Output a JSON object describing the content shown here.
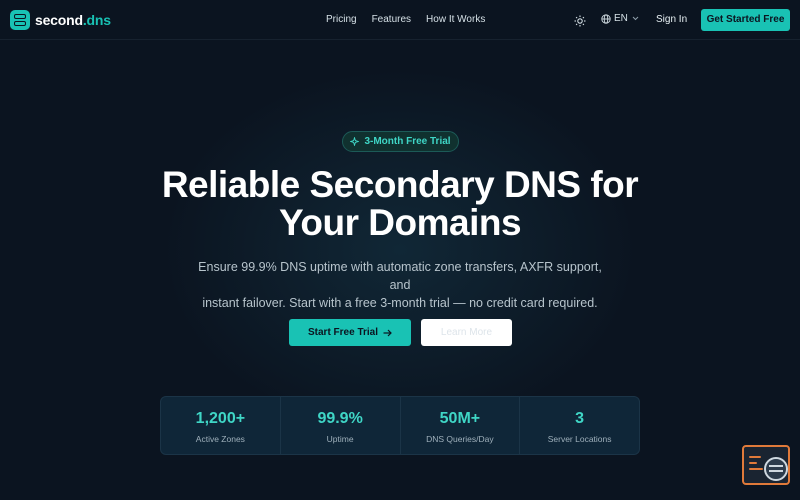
{
  "brand": {
    "name_part1": "second",
    "name_part2": ".dns",
    "accent_color": "#19c2b4"
  },
  "nav": {
    "links": [
      "Pricing",
      "Features",
      "How It Works"
    ],
    "language": "EN",
    "sign_in": "Sign In",
    "cta": "Get Started Free",
    "icons": [
      "sun-icon",
      "globe-icon",
      "chevron-down-icon"
    ]
  },
  "hero": {
    "badge": "3-Month Free Trial",
    "title_line1": "Reliable Secondary DNS for",
    "title_line2": "Your Domains",
    "subtitle_line1": "Ensure 99.9% DNS uptime with automatic zone transfers, AXFR support, and",
    "subtitle_line2": "instant failover. Start with a free 3-month trial — no credit card required.",
    "primary_button": "Start Free Trial",
    "secondary_button": "Learn More"
  },
  "stats": [
    {
      "value": "1,200+",
      "label": "Active Zones"
    },
    {
      "value": "99.9%",
      "label": "Uptime"
    },
    {
      "value": "50M+",
      "label": "DNS Queries/Day"
    },
    {
      "value": "3",
      "label": "Server Locations"
    }
  ],
  "colors": {
    "background": "#0b1420",
    "accent": "#19c2b4",
    "accent_text": "#3fd6c6",
    "widget_border": "#e07a3a"
  }
}
